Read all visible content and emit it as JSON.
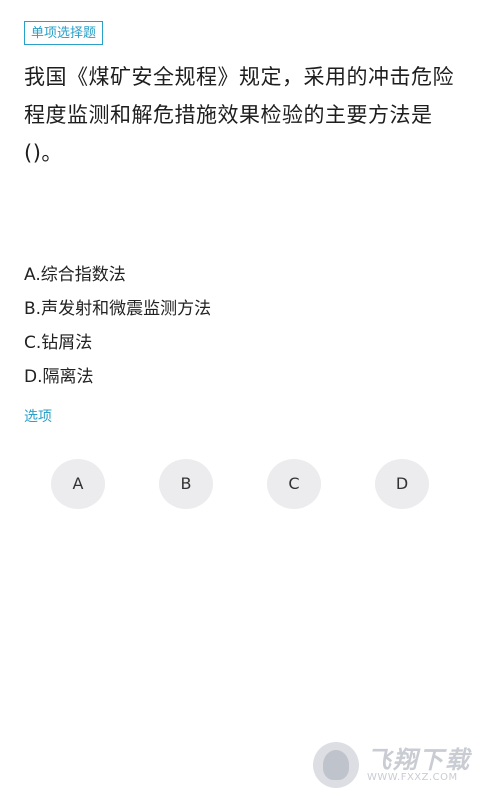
{
  "question": {
    "type_badge": "单项选择题",
    "text": "我国《煤矿安全规程》规定，采用的冲击危险程度监测和解危措施效果检验的主要方法是()。"
  },
  "options": [
    {
      "text": "A.综合指数法"
    },
    {
      "text": "B.声发射和微震监测方法"
    },
    {
      "text": "C.钻屑法"
    },
    {
      "text": "D.隔离法"
    }
  ],
  "answer_section": {
    "label": "选项",
    "buttons": [
      "A",
      "B",
      "C",
      "D"
    ]
  },
  "watermark": {
    "title": "飞翔下载",
    "url": "WWW.FXXZ.COM"
  },
  "colors": {
    "accent": "#29a0c8",
    "button_bg": "#ececef",
    "watermark": "#c9ccd3"
  }
}
